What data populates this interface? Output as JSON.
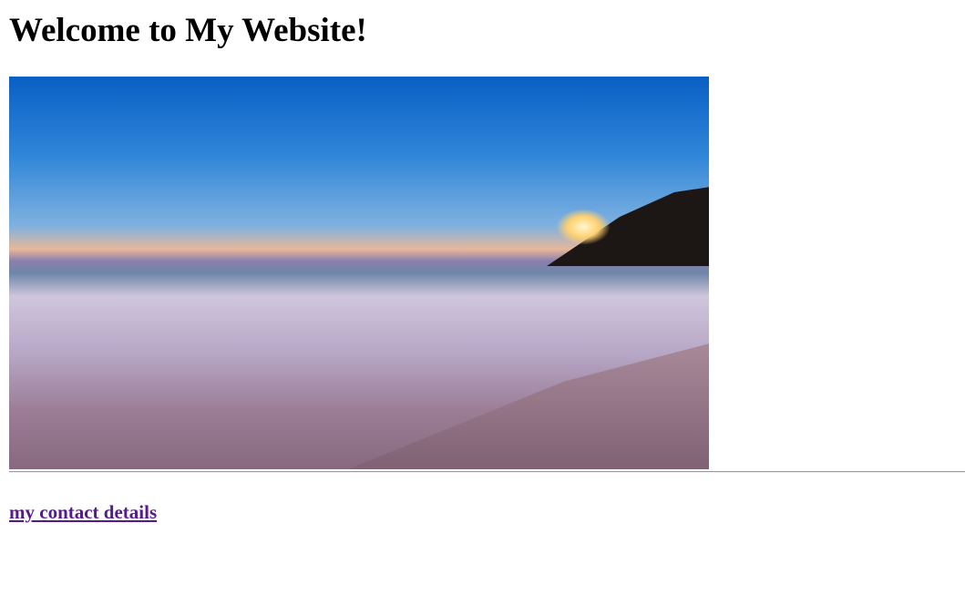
{
  "page": {
    "heading": "Welcome to My Website!",
    "image_subject": "beach-sunset-image",
    "link": "my contact details"
  }
}
